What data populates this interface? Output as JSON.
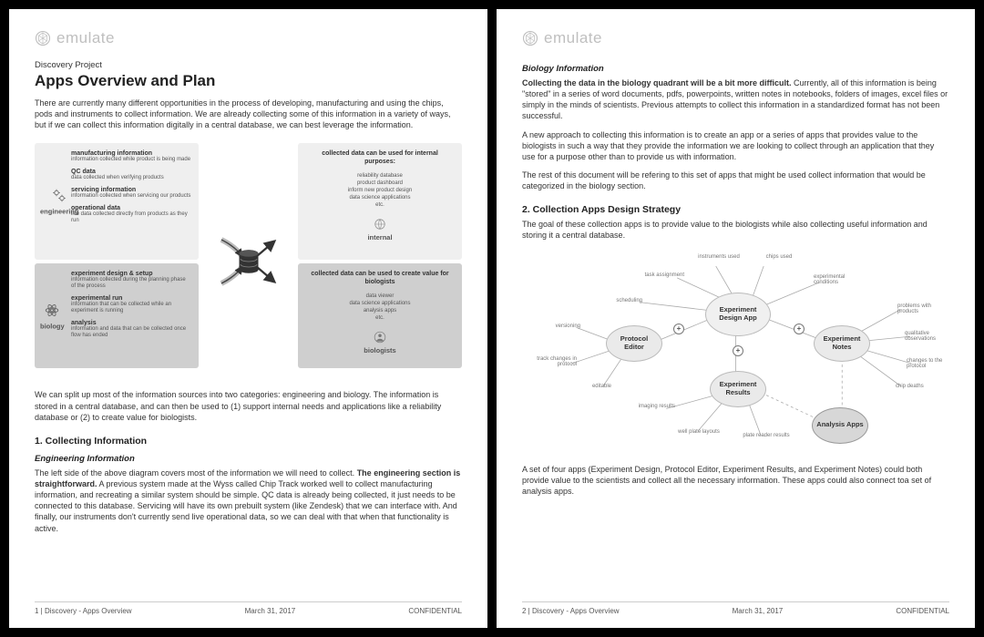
{
  "brand": "emulate",
  "page1": {
    "eyebrow": "Discovery Project",
    "title": "Apps Overview and Plan",
    "intro": "There are currently many different opportunities in the process of developing, manufacturing and using the chips, pods and instruments to collect information. We are already collecting some of this information in a variety of ways, but if we can collect this information digitally in a central database, we can best leverage the information.",
    "diagram": {
      "eng": {
        "label": "engineering",
        "items": [
          {
            "t": "manufacturing information",
            "d": "information collected while product is being made"
          },
          {
            "t": "QC data",
            "d": "data collected when verifying products"
          },
          {
            "t": "servicing information",
            "d": "information collected when servicing our products"
          },
          {
            "t": "operational data",
            "d": "live data collected directly from products as they run"
          }
        ]
      },
      "bio": {
        "label": "biology",
        "items": [
          {
            "t": "experiment design & setup",
            "d": "information collected during the planning phase of the process"
          },
          {
            "t": "experimental run",
            "d": "information that can be collected while an experiment is running"
          },
          {
            "t": "analysis",
            "d": "information and data that can be collected once flow has ended"
          }
        ]
      },
      "internal": {
        "head": "collected data can be used for internal purposes:",
        "list": "reliability database\nproduct dashboard\ninform new product design\ndata science applications\netc.",
        "persona": "internal"
      },
      "biologists": {
        "head": "collected data can be used to create value for biologists",
        "list": "data viewer\ndata science applications\nanalysis apps\netc.",
        "persona": "biologists"
      }
    },
    "para2": "We can split up most of the information sources into two categories: engineering and biology. The information is stored in a central database, and can then be used to (1) support internal needs and applications like a reliability database or (2) to create value for biologists.",
    "h2": "1. Collecting Information",
    "h3": "Engineering Information",
    "para3_bold": "The engineering section is straightforward.",
    "para3_pre": "The left side of the above diagram covers most of the information we will need to collect. ",
    "para3_post": " A previous system made at the Wyss called Chip Track worked well to collect manufacturing information, and recreating a similar system should be simple. QC data is already being collected, it just needs to be connected to this database. Servicing will have its own prebuilt system (like Zendesk) that we can interface with. And finally, our instruments don't currently send live operational data, so we can deal with that when that functionality is active.",
    "footer": {
      "left": "1 | Discovery - Apps Overview",
      "center": "March 31, 2017",
      "right": "CONFIDENTIAL"
    }
  },
  "page2": {
    "h3a": "Biology Information",
    "p1_bold": "Collecting the data in the biology quadrant will be a bit more difficult.",
    "p1_post": " Currently, all of this information is being \"stored\" in a series of word documents, pdfs, powerpoints, written notes in notebooks, folders of images, excel files or simply in the minds of scientists. Previous attempts to collect this information in a standardized format has not been successful.",
    "p2": "A new approach to collecting this information is to create an app or a series of apps that provides value to the biologists in such a way that they provide the information we are looking to collect through an application that they use for a purpose other than to provide us with information.",
    "p3": "The rest of this document will be refering to this set of apps that might be used collect information that would be categorized in the biology section.",
    "h2": "2. Collection Apps Design Strategy",
    "p4": "The goal of these collection apps is to provide value to the biologists while also collecting useful information and storing it a central database.",
    "diagram": {
      "nodes": {
        "design": "Experiment Design App",
        "protocol": "Protocol Editor",
        "notes": "Experiment Notes",
        "results": "Experiment Results",
        "analysis": "Analysis Apps"
      },
      "leaves": {
        "task_assignment": "task assignment",
        "instruments_used": "instruments used",
        "chips_used": "chips used",
        "experimental_conditions": "experimental conditions",
        "scheduling": "scheduling",
        "versioning": "versioning",
        "track_changes": "track changes in protocol",
        "editable": "editable",
        "imaging_results": "imaging results",
        "well_plate": "well plate layouts",
        "plate_reader": "plate reader results",
        "problems": "problems with products",
        "qualitative": "qualitative observations",
        "changes_protocol": "changes to the protocol",
        "chip_deaths": "chip deaths"
      }
    },
    "p5": "A set of four apps (Experiment Design, Protocol Editor, Experiment Results, and Experiment Notes) could both provide value to the scientists and collect all the necessary information. These apps could also connect toa set of analysis apps.",
    "footer": {
      "left": "2 | Discovery - Apps Overview",
      "center": "March 31, 2017",
      "right": "CONFIDENTIAL"
    }
  }
}
